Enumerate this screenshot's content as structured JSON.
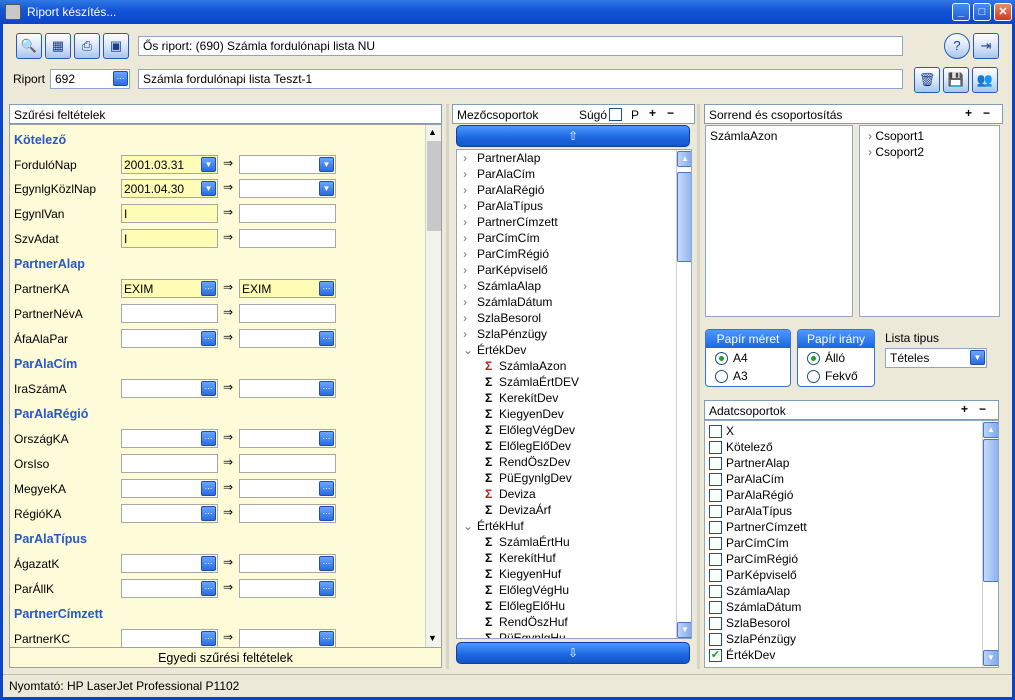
{
  "window": {
    "title": "Riport készítés..."
  },
  "header": {
    "os_riport": "Ős riport: (690)  Számla fordulónapi lista NU",
    "riport_label": "Riport",
    "riport_id": "692",
    "riport_name": "Számla fordulónapi lista Teszt-1"
  },
  "filter": {
    "title": "Szűrési feltételek",
    "footer": "Egyedi szűrési feltételek",
    "arrow": "⇒",
    "sections": {
      "kotelezo": "Kötelező",
      "partneralap": "PartnerAlap",
      "paralacim": "ParAlaCím",
      "paralaregio": "ParAlaRégió",
      "paralatipus": "ParAlaTípus",
      "partnercimzett": "PartnerCímzett"
    },
    "rows": {
      "fordulonap": {
        "label": "FordulóNap",
        "from": "2001.03.31",
        "to": ""
      },
      "egynlgkozlnap": {
        "label": "EgynlgKözlNap",
        "from": "2001.04.30",
        "to": ""
      },
      "egynlvan": {
        "label": "EgynlVan",
        "from": "I",
        "to": ""
      },
      "szvadat": {
        "label": "SzvAdat",
        "from": "I",
        "to": ""
      },
      "partnerka": {
        "label": "PartnerKA",
        "from": "EXIM",
        "to": "EXIM"
      },
      "partnernevá": {
        "label": "PartnerNévA",
        "from": "",
        "to": ""
      },
      "afaalapar": {
        "label": "ÁfaAlaPar",
        "from": "",
        "to": ""
      },
      "iraszama": {
        "label": "IraSzámA",
        "from": "",
        "to": ""
      },
      "orszagka": {
        "label": "OrszágKA",
        "from": "",
        "to": ""
      },
      "orsiso": {
        "label": "OrsIso",
        "from": "",
        "to": ""
      },
      "megyeka": {
        "label": "MegyeKA",
        "from": "",
        "to": ""
      },
      "regioka": {
        "label": "RégióKA",
        "from": "",
        "to": ""
      },
      "agazatk": {
        "label": "ÁgazatK",
        "from": "",
        "to": ""
      },
      "parallk": {
        "label": "ParÁllK",
        "from": "",
        "to": ""
      },
      "partnerkc": {
        "label": "PartnerKC",
        "from": "",
        "to": ""
      }
    }
  },
  "mezo": {
    "title": "Mezőcsoportok",
    "sugo": "Súgó",
    "p": "P",
    "plus": "+",
    "minus": "−",
    "tree": [
      {
        "label": "PartnerAlap",
        "type": "group"
      },
      {
        "label": "ParAlaCím",
        "type": "group"
      },
      {
        "label": "ParAlaRégió",
        "type": "group"
      },
      {
        "label": "ParAlaTípus",
        "type": "group"
      },
      {
        "label": "PartnerCímzett",
        "type": "group"
      },
      {
        "label": "ParCímCím",
        "type": "group"
      },
      {
        "label": "ParCímRégió",
        "type": "group"
      },
      {
        "label": "ParKépviselő",
        "type": "group"
      },
      {
        "label": "SzámlaAlap",
        "type": "group"
      },
      {
        "label": "SzámlaDátum",
        "type": "group"
      },
      {
        "label": "SzlaBesorol",
        "type": "group"
      },
      {
        "label": "SzlaPénzügy",
        "type": "group"
      },
      {
        "label": "ÉrtékDev",
        "type": "open"
      },
      {
        "label": "SzámlaAzon",
        "type": "sumred"
      },
      {
        "label": "SzámlaÉrtDEV",
        "type": "sum"
      },
      {
        "label": "KerekítDev",
        "type": "sum"
      },
      {
        "label": "KiegyenDev",
        "type": "sum"
      },
      {
        "label": "ElőlegVégDev",
        "type": "sum"
      },
      {
        "label": "ElőlegElőDev",
        "type": "sum"
      },
      {
        "label": "RendÖszDev",
        "type": "sum"
      },
      {
        "label": "PüEgynlgDev",
        "type": "sum"
      },
      {
        "label": "Deviza",
        "type": "sumred"
      },
      {
        "label": "DevizaÁrf",
        "type": "sum"
      },
      {
        "label": "ÉrtékHuf",
        "type": "open"
      },
      {
        "label": "SzámlaÉrtHu",
        "type": "sum"
      },
      {
        "label": "KerekítHuf",
        "type": "sum"
      },
      {
        "label": "KiegyenHuf",
        "type": "sum"
      },
      {
        "label": "ElőlegVégHu",
        "type": "sum"
      },
      {
        "label": "ElőlegElőHu",
        "type": "sum"
      },
      {
        "label": "RendÖszHuf",
        "type": "sum"
      },
      {
        "label": "PüEgynlgHu",
        "type": "sum"
      }
    ]
  },
  "sorrend": {
    "title": "Sorrend és csoportosítás",
    "left_items": [
      "SzámlaAzon"
    ],
    "right_items": [
      "Csoport1",
      "Csoport2"
    ]
  },
  "papir_meret": {
    "title": "Papír méret",
    "options": [
      "A4",
      "A3"
    ],
    "selected": "A4"
  },
  "papir_irany": {
    "title": "Papír irány",
    "options": [
      "Álló",
      "Fekvő"
    ],
    "selected": "Álló"
  },
  "lista_tipus": {
    "label": "Lista tipus",
    "value": "Tételes"
  },
  "adatcsoportok": {
    "title": "Adatcsoportok",
    "items": [
      {
        "label": "X",
        "checked": false
      },
      {
        "label": "Kötelező",
        "checked": false
      },
      {
        "label": "PartnerAlap",
        "checked": false
      },
      {
        "label": "ParAlaCím",
        "checked": false
      },
      {
        "label": "ParAlaRégió",
        "checked": false
      },
      {
        "label": "ParAlaTípus",
        "checked": false
      },
      {
        "label": "PartnerCímzett",
        "checked": false
      },
      {
        "label": "ParCímCím",
        "checked": false
      },
      {
        "label": "ParCímRégió",
        "checked": false
      },
      {
        "label": "ParKépviselő",
        "checked": false
      },
      {
        "label": "SzámlaAlap",
        "checked": false
      },
      {
        "label": "SzámlaDátum",
        "checked": false
      },
      {
        "label": "SzlaBesorol",
        "checked": false
      },
      {
        "label": "SzlaPénzügy",
        "checked": false
      },
      {
        "label": "ÉrtékDev",
        "checked": true
      }
    ]
  },
  "status": {
    "printer": "Nyomtató: HP LaserJet Professional P1102"
  }
}
